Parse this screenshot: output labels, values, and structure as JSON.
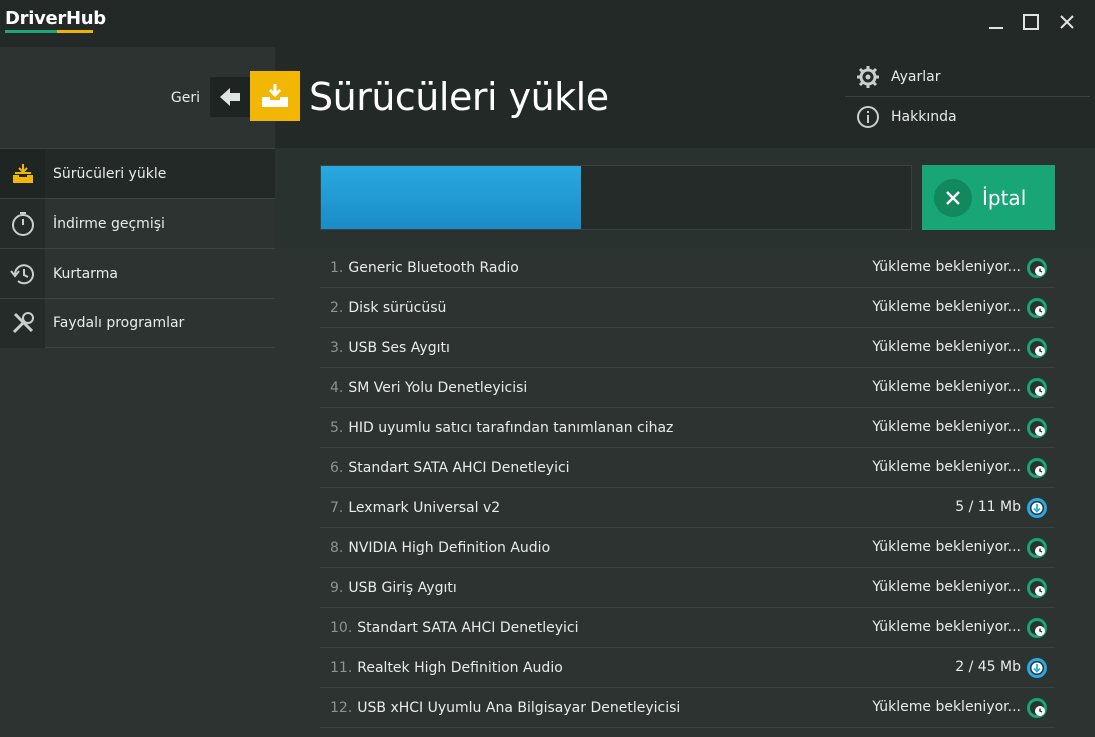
{
  "app": {
    "title": "DriverHub"
  },
  "colors": {
    "accent_green": "#18a677",
    "accent_yellow": "#f2b705",
    "progress_blue": "#2aa8e0"
  },
  "window_controls": [
    "minimize-icon",
    "maximize-icon",
    "close-icon"
  ],
  "sidebar": {
    "back_label": "Geri",
    "items": [
      {
        "label": "Sürücüleri yükle",
        "icon": "install-tray-icon",
        "active": true
      },
      {
        "label": "İndirme geçmişi",
        "icon": "timer-icon",
        "active": false
      },
      {
        "label": "Kurtarma",
        "icon": "history-icon",
        "active": false
      },
      {
        "label": "Faydalı programlar",
        "icon": "tools-icon",
        "active": false
      }
    ]
  },
  "header": {
    "title": "Sürücüleri yükle",
    "menu": [
      {
        "label": "Ayarlar",
        "icon": "gear-icon"
      },
      {
        "label": "Hakkında",
        "icon": "info-icon"
      }
    ]
  },
  "progress": {
    "percent": 44,
    "cancel_label": "İptal"
  },
  "drivers": [
    {
      "num": "1.",
      "name": "Generic Bluetooth Radio",
      "status": "Yükleme bekleniyor...",
      "state": "waiting"
    },
    {
      "num": "2.",
      "name": "Disk sürücüsü",
      "status": "Yükleme bekleniyor...",
      "state": "waiting"
    },
    {
      "num": "3.",
      "name": "USB Ses Aygıtı",
      "status": "Yükleme bekleniyor...",
      "state": "waiting"
    },
    {
      "num": "4.",
      "name": "SM Veri Yolu Denetleyicisi",
      "status": "Yükleme bekleniyor...",
      "state": "waiting"
    },
    {
      "num": "5.",
      "name": "HID uyumlu satıcı tarafından tanımlanan cihaz",
      "status": "Yükleme bekleniyor...",
      "state": "waiting"
    },
    {
      "num": "6.",
      "name": "Standart SATA AHCI Denetleyici",
      "status": "Yükleme bekleniyor...",
      "state": "waiting"
    },
    {
      "num": "7.",
      "name": "Lexmark Universal v2",
      "status": "5 / 11 Mb",
      "state": "downloading"
    },
    {
      "num": "8.",
      "name": "NVIDIA High Definition Audio",
      "status": "Yükleme bekleniyor...",
      "state": "waiting"
    },
    {
      "num": "9.",
      "name": "USB Giriş Aygıtı",
      "status": "Yükleme bekleniyor...",
      "state": "waiting"
    },
    {
      "num": "10.",
      "name": "Standart SATA AHCI Denetleyici",
      "status": "Yükleme bekleniyor...",
      "state": "waiting"
    },
    {
      "num": "11.",
      "name": "Realtek High Definition Audio",
      "status": "2 / 45 Mb",
      "state": "downloading"
    },
    {
      "num": "12.",
      "name": "USB xHCI Uyumlu Ana Bilgisayar Denetleyicisi",
      "status": "Yükleme bekleniyor...",
      "state": "waiting"
    }
  ]
}
